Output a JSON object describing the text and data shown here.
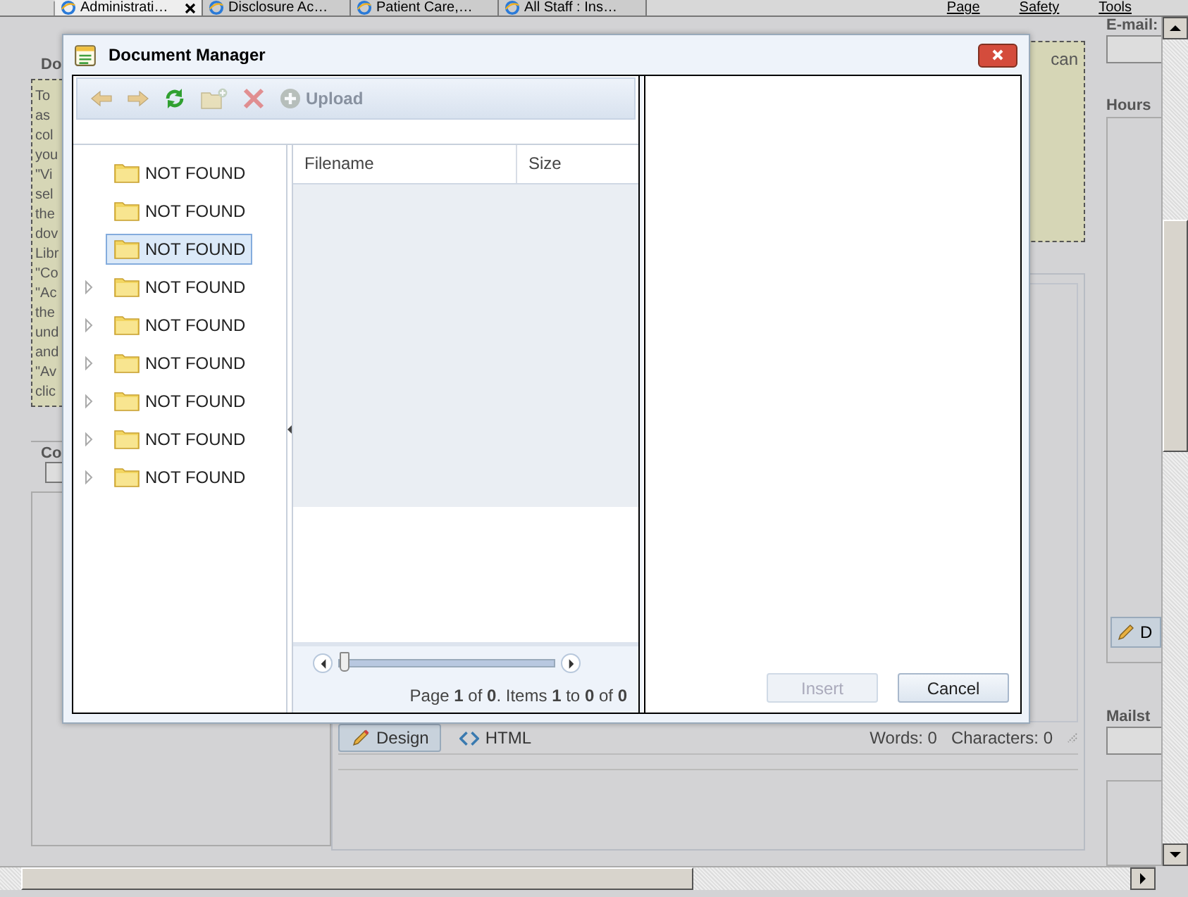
{
  "browser": {
    "tabs": [
      {
        "label": "Administrati…",
        "selected": true
      },
      {
        "label": "Disclosure Ac…",
        "selected": false
      },
      {
        "label": "Patient Care,…",
        "selected": false
      },
      {
        "label": "All Staff : Ins…",
        "selected": false
      }
    ],
    "menu": [
      "Page",
      "Safety",
      "Tools"
    ]
  },
  "page": {
    "left": {
      "heading": "Do",
      "note_lines": [
        "To",
        "as",
        "col",
        "you",
        "\"Vi",
        "sel",
        "the",
        "dov",
        "Libr",
        "\"Co",
        "\"Ac",
        "the",
        "und",
        "and",
        "\"Av",
        "clic"
      ],
      "label": "Co",
      "checked": false
    },
    "note_fragment": "can",
    "editor": {
      "modes": [
        {
          "label": "Design",
          "selected": true
        },
        {
          "label": "HTML",
          "selected": false
        }
      ],
      "words": "Words: 0",
      "characters": "Characters: 0"
    },
    "right": {
      "email_label": "E-mail:",
      "hours_label": "Hours",
      "design_button": "D",
      "mailstop_label": "Mailst"
    }
  },
  "dialog": {
    "title": "Document Manager",
    "toolbar": [
      {
        "kind": "back",
        "disabled": true
      },
      {
        "kind": "forward",
        "disabled": true
      },
      {
        "kind": "refresh",
        "disabled": false
      },
      {
        "kind": "new-folder",
        "disabled": true
      },
      {
        "kind": "delete",
        "disabled": true
      },
      {
        "kind": "upload",
        "disabled": true,
        "label": "Upload"
      }
    ],
    "tree": [
      {
        "label": "NOT FOUND",
        "has_children": false,
        "selected": false
      },
      {
        "label": "NOT FOUND",
        "has_children": false,
        "selected": false
      },
      {
        "label": "NOT FOUND",
        "has_children": false,
        "selected": true
      },
      {
        "label": "NOT FOUND",
        "has_children": true,
        "selected": false
      },
      {
        "label": "NOT FOUND",
        "has_children": true,
        "selected": false
      },
      {
        "label": "NOT FOUND",
        "has_children": true,
        "selected": false
      },
      {
        "label": "NOT FOUND",
        "has_children": true,
        "selected": false
      },
      {
        "label": "NOT FOUND",
        "has_children": true,
        "selected": false
      },
      {
        "label": "NOT FOUND",
        "has_children": true,
        "selected": false
      }
    ],
    "grid": {
      "columns": [
        "Filename",
        "Size"
      ],
      "slider": {
        "level": 0
      },
      "pager": "Page **1** of **0**. Items **1** to **0** of **0**"
    },
    "buttons": [
      {
        "label": "Insert",
        "disabled": true
      },
      {
        "label": "Cancel",
        "disabled": false
      }
    ]
  }
}
